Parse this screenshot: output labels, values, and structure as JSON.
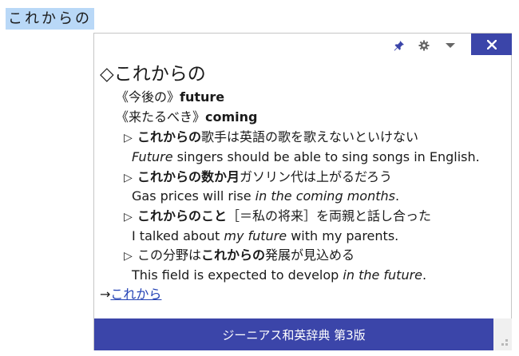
{
  "selection": {
    "text": "これからの"
  },
  "toolbar": {
    "pin_icon": "pin-icon",
    "settings_icon": "gear-icon",
    "menu_icon": "chevron-down-icon",
    "close_icon": "close-icon",
    "accent": "#3b45a9"
  },
  "entry": {
    "headword": "◇これからの",
    "senses": [
      {
        "tag": "《今後の》",
        "english": "future"
      },
      {
        "tag": "《来たるべき》",
        "english": "coming"
      }
    ],
    "examples": [
      {
        "ja_bold": "これからの",
        "ja_rest": "歌手は英語の歌を歌えないといけない",
        "en_pre": "",
        "en_em": "Future",
        "en_post": " singers should be able to sing songs in English."
      },
      {
        "ja_bold": "これからの数か月",
        "ja_rest": "ガソリン代は上がるだろう",
        "en_pre": "Gas prices will rise ",
        "en_em": "in the coming months",
        "en_post": "."
      },
      {
        "ja_bold": "これからのこと",
        "ja_rest": "［＝私の将来］を両親と話し合った",
        "en_pre": "I talked about ",
        "en_em": "my future",
        "en_post": " with my parents."
      },
      {
        "ja_pre": "この分野は",
        "ja_bold": "これからの",
        "ja_rest": "発展が見込める",
        "en_pre": "This field is expected to develop ",
        "en_em": "in the future",
        "en_post": "."
      }
    ],
    "xref_arrow": "→",
    "xref_link": "これから"
  },
  "footer": {
    "dictionary": "ジーニアス和英辞典 第3版"
  }
}
